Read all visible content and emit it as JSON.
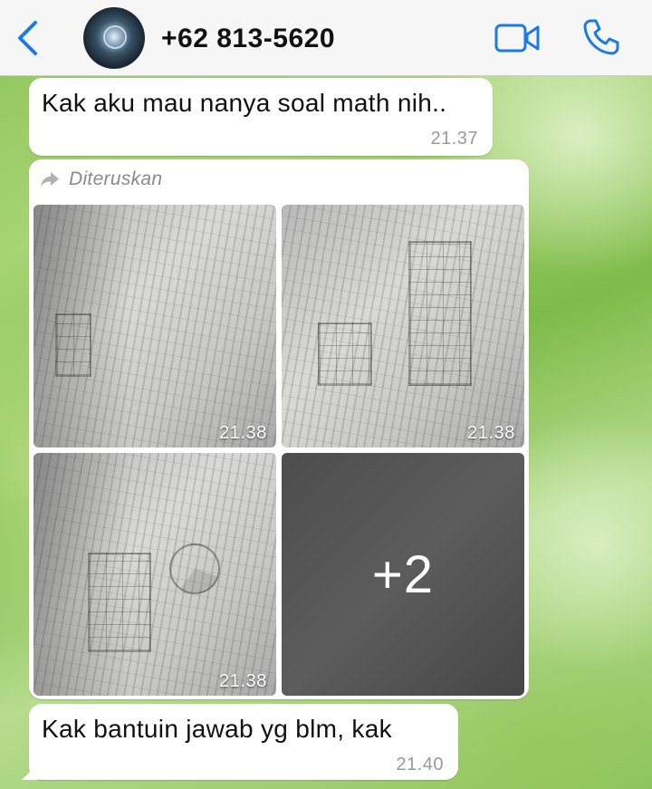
{
  "header": {
    "contact_name": "+62 813-5620",
    "back_icon": "chevron-left-icon",
    "video_icon": "video-camera-icon",
    "call_icon": "phone-icon",
    "accent_color": "#1b7be0"
  },
  "messages": [
    {
      "text": "Kak aku mau nanya soal math nih..",
      "time": "21.37"
    },
    {
      "forwarded_label": "Diteruskan",
      "forwarded_icon": "forward-arrow-icon",
      "photos": [
        {
          "time": "21.38"
        },
        {
          "time": "21.38"
        },
        {
          "time": "21.38"
        }
      ],
      "more_count": "+2"
    },
    {
      "text": "Kak bantuin jawab yg blm, kak",
      "time": "21.40"
    }
  ]
}
